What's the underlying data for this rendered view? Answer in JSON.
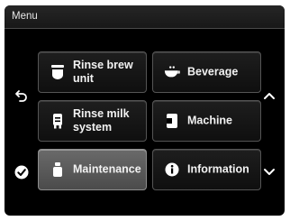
{
  "header": {
    "title": "Menu"
  },
  "nav": {
    "back_icon": "back-arrow-icon",
    "confirm_icon": "checkmark-icon",
    "up_icon": "chevron-up-icon",
    "down_icon": "chevron-down-icon"
  },
  "tiles": [
    {
      "label": "Rinse brew\nunit",
      "icon": "brew-unit-icon",
      "selected": false
    },
    {
      "label": "Beverage",
      "icon": "beverage-icon",
      "selected": false
    },
    {
      "label": "Rinse milk\nsystem",
      "icon": "milk-system-icon",
      "selected": false
    },
    {
      "label": "Machine",
      "icon": "machine-icon",
      "selected": false
    },
    {
      "label": "Maintenance",
      "icon": "maintenance-icon",
      "selected": true
    },
    {
      "label": "Information",
      "icon": "info-icon",
      "selected": false
    }
  ],
  "colors": {
    "background": "#000000",
    "tile": "#161616",
    "tile_selected": "#5a5a5a",
    "text": "#f2f2f2"
  }
}
